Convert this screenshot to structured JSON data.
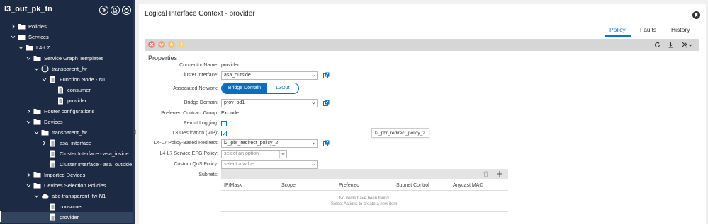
{
  "sidebar": {
    "title": "l3_out_pk_tn",
    "tree": [
      {
        "label": "Policies",
        "type": "folder",
        "chevron": "right"
      },
      {
        "label": "Services",
        "type": "folder",
        "chevron": "down"
      },
      {
        "label": "L4-L7",
        "type": "folder",
        "chevron": "down"
      },
      {
        "label": "Service Graph Templates",
        "type": "folder",
        "chevron": "down"
      },
      {
        "label": "transparent_fw",
        "type": "graph",
        "chevron": "down"
      },
      {
        "label": "Function Node - N1",
        "type": "doc",
        "chevron": "down"
      },
      {
        "label": "consumer",
        "type": "doc",
        "chevron": ""
      },
      {
        "label": "provider",
        "type": "doc",
        "chevron": ""
      },
      {
        "label": "Router configurations",
        "type": "folder",
        "chevron": "right"
      },
      {
        "label": "Devices",
        "type": "folder",
        "chevron": "down"
      },
      {
        "label": "transparent_fw",
        "type": "folder",
        "chevron": "down"
      },
      {
        "label": "asa_interface",
        "type": "doc",
        "chevron": "right"
      },
      {
        "label": "Cluster Interface - asa_inside",
        "type": "doc",
        "chevron": ""
      },
      {
        "label": "Cluster Interface - asa_outside",
        "type": "doc",
        "chevron": ""
      },
      {
        "label": "Imported Devices",
        "type": "folder",
        "chevron": "right"
      },
      {
        "label": "Devices Selection Policies",
        "type": "folder",
        "chevron": "down"
      },
      {
        "label": "abc-transparent_fw-N1",
        "type": "cloud",
        "chevron": "down"
      },
      {
        "label": "consumer",
        "type": "doc",
        "chevron": ""
      },
      {
        "label": "provider",
        "type": "doc",
        "chevron": ""
      }
    ]
  },
  "main": {
    "title": "Logical Interface Context - provider",
    "tabs": [
      "Policy",
      "Faults",
      "History"
    ],
    "active_tab": "Policy",
    "section_title": "Properties",
    "fields": {
      "connector_name_label": "Connector Name:",
      "connector_name_value": "provider",
      "cluster_interface_label": "Cluster Interface:",
      "cluster_interface_value": "asa_outside",
      "associated_network_label": "Associated Network:",
      "associated_network_options": [
        "Bridge Domain",
        "L3Out"
      ],
      "bridge_domain_label": "Bridge Domain:",
      "bridge_domain_value": "prov_bd1",
      "preferred_contract_group_label": "Preferred Contract Group:",
      "preferred_contract_group_value": "Exclude",
      "permit_logging_label": "Permit Logging:",
      "l3_destination_label": "L3 Destination (VIP):",
      "pbr_label": "L4-L7 Policy-Based Redirect:",
      "pbr_value": "l2_pbr_redirect_policy_2",
      "service_epg_label": "L4-L7 Service EPG Policy:",
      "service_epg_placeholder": "select an option",
      "qos_label": "Custom QoS Policy:",
      "qos_placeholder": "select a value",
      "subnets_label": "Subnets:"
    },
    "tooltip": "l2_pbr_redirect_policy_2",
    "subnets_table": {
      "columns": [
        "IP/Mask",
        "Scope",
        "Preferred",
        "Subnet Control",
        "Anycast MAC"
      ],
      "empty_line1": "No items have been found.",
      "empty_line2": "Select Actions to create a new item."
    }
  },
  "colors": {
    "sidebar_bg": "#1d2a44",
    "accent": "#0a75c2",
    "fault_critical": "#e8796f",
    "fault_major": "#f0a172",
    "fault_minor": "#f3c069",
    "fault_warning": "#f3d47a"
  }
}
